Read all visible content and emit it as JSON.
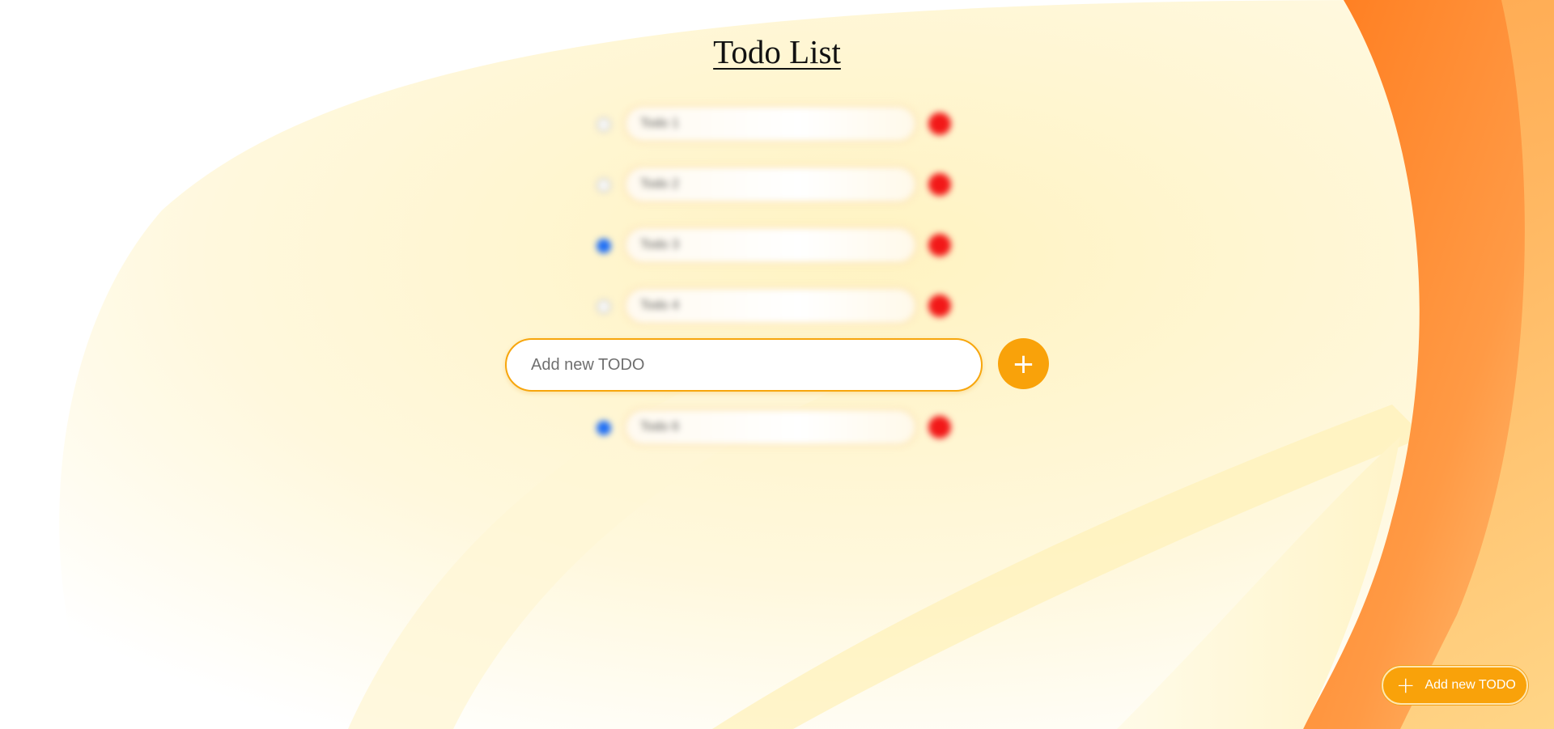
{
  "page": {
    "title": "Todo List"
  },
  "todos": [
    {
      "text": "Todo 1",
      "done": false
    },
    {
      "text": "Todo 2",
      "done": false
    },
    {
      "text": "Todo 3",
      "done": true
    },
    {
      "text": "Todo 4",
      "done": false
    },
    {
      "text": "Todo 6",
      "done": true
    }
  ],
  "new_todo": {
    "placeholder": "Add new TODO",
    "add_icon": "+",
    "add_icon_name": "plus-icon"
  },
  "fab": {
    "icon": "+",
    "label": "Add new TODO"
  },
  "colors": {
    "accent": "#f9a20a",
    "delete": "#f21818",
    "checked": "#1f6ef5",
    "background_orange": "#ff7a1a",
    "background_yellow": "#fff0b0"
  }
}
